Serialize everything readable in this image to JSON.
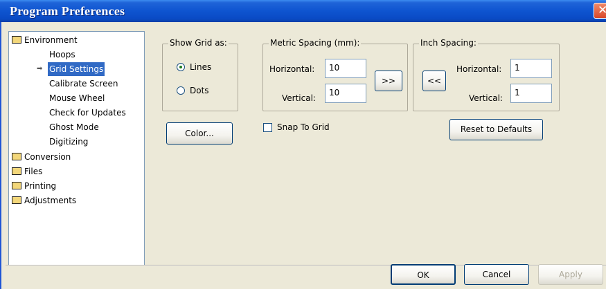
{
  "window": {
    "title": "Program Preferences",
    "close_glyph": "✕"
  },
  "tree": {
    "environment": "Environment",
    "children": [
      "Hoops",
      "Grid Settings",
      "Calibrate Screen",
      "Mouse Wheel",
      "Check for Updates",
      "Ghost Mode",
      "Digitizing"
    ],
    "folders": [
      "Conversion",
      "Files",
      "Printing",
      "Adjustments"
    ],
    "selected": "Grid Settings"
  },
  "show_grid": {
    "title": "Show Grid as:",
    "lines": "Lines",
    "dots": "Dots",
    "selected": "Lines"
  },
  "metric": {
    "title": "Metric Spacing (mm):",
    "horizontal_label": "Horizontal:",
    "horizontal_value": "10",
    "vertical_label": "Vertical:",
    "vertical_value": "10",
    "convert_button": ">>"
  },
  "inch": {
    "title": "Inch Spacing:",
    "horizontal_label": "Horizontal:",
    "horizontal_value": "1",
    "vertical_label": "Vertical:",
    "vertical_value": "1",
    "convert_button": "<<"
  },
  "color_button": "Color...",
  "snap_to_grid": {
    "label": "Snap To Grid",
    "checked": false
  },
  "reset_button": "Reset to Defaults",
  "footer": {
    "ok": "OK",
    "cancel": "Cancel",
    "apply": "Apply"
  },
  "colors": {
    "titlebar": "#0a4ac4",
    "selection": "#316ac5",
    "window_bg": "#ece9d8",
    "close_button": "#d8482a"
  }
}
